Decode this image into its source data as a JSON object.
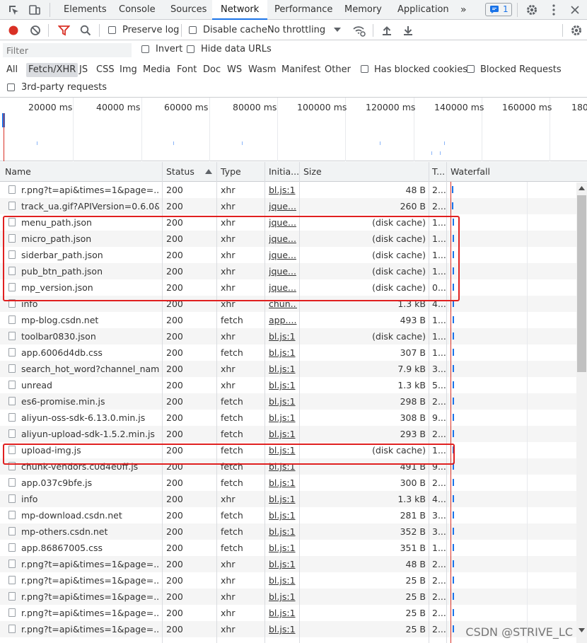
{
  "tabs": {
    "items": [
      "Elements",
      "Console",
      "Sources",
      "Network",
      "Performance",
      "Memory",
      "Application"
    ],
    "more": "»",
    "issues_count": "1"
  },
  "toolbar": {
    "preserve_log": "Preserve log",
    "disable_cache": "Disable cache",
    "throttling": "No throttling"
  },
  "filter": {
    "placeholder": "Filter",
    "invert": "Invert",
    "hide_data_urls": "Hide data URLs"
  },
  "types": {
    "items": [
      "All",
      "Fetch/XHR",
      "JS",
      "CSS",
      "Img",
      "Media",
      "Font",
      "Doc",
      "WS",
      "Wasm",
      "Manifest",
      "Other"
    ],
    "selected": "Fetch/XHR",
    "blocked_cookies": "Has blocked cookies",
    "blocked_requests": "Blocked Requests",
    "third_party": "3rd-party requests"
  },
  "overview": {
    "ticks": [
      "20000 ms",
      "40000 ms",
      "60000 ms",
      "80000 ms",
      "100000 ms",
      "120000 ms",
      "140000 ms",
      "160000 ms",
      "180"
    ]
  },
  "table": {
    "headers": {
      "name": "Name",
      "status": "Status",
      "type": "Type",
      "initiator": "Initia...",
      "size": "Size",
      "time": "T...",
      "waterfall": "Waterfall"
    },
    "rows": [
      {
        "name": "r.png?t=api&times=1&page=...",
        "status": "200",
        "type": "xhr",
        "initiator": "bl.js:1",
        "size": "48 B",
        "time": "2..."
      },
      {
        "name": "track_ua.gif?APIVersion=0.6.0&...",
        "status": "200",
        "type": "xhr",
        "initiator": "jque...",
        "size": "260 B",
        "time": "2..."
      },
      {
        "name": "menu_path.json",
        "status": "200",
        "type": "xhr",
        "initiator": "jque...",
        "size": "(disk cache)",
        "time": "1..."
      },
      {
        "name": "micro_path.json",
        "status": "200",
        "type": "xhr",
        "initiator": "jque...",
        "size": "(disk cache)",
        "time": "1..."
      },
      {
        "name": "siderbar_path.json",
        "status": "200",
        "type": "xhr",
        "initiator": "jque...",
        "size": "(disk cache)",
        "time": "1..."
      },
      {
        "name": "pub_btn_path.json",
        "status": "200",
        "type": "xhr",
        "initiator": "jque...",
        "size": "(disk cache)",
        "time": "1..."
      },
      {
        "name": "mp_version.json",
        "status": "200",
        "type": "xhr",
        "initiator": "jque...",
        "size": "(disk cache)",
        "time": "0..."
      },
      {
        "name": "info",
        "status": "200",
        "type": "xhr",
        "initiator": "chun...",
        "size": "1.3 kB",
        "time": "4..."
      },
      {
        "name": "mp-blog.csdn.net",
        "status": "200",
        "type": "fetch",
        "initiator": "app....",
        "size": "493 B",
        "time": "1..."
      },
      {
        "name": "toolbar0830.json",
        "status": "200",
        "type": "xhr",
        "initiator": "bl.js:1",
        "size": "(disk cache)",
        "time": "1..."
      },
      {
        "name": "app.6006d4db.css",
        "status": "200",
        "type": "fetch",
        "initiator": "bl.js:1",
        "size": "307 B",
        "time": "1..."
      },
      {
        "name": "search_hot_word?channel_nam...",
        "status": "200",
        "type": "xhr",
        "initiator": "bl.js:1",
        "size": "7.9 kB",
        "time": "3..."
      },
      {
        "name": "unread",
        "status": "200",
        "type": "xhr",
        "initiator": "bl.js:1",
        "size": "1.3 kB",
        "time": "5..."
      },
      {
        "name": "es6-promise.min.js",
        "status": "200",
        "type": "fetch",
        "initiator": "bl.js:1",
        "size": "298 B",
        "time": "2..."
      },
      {
        "name": "aliyun-oss-sdk-6.13.0.min.js",
        "status": "200",
        "type": "fetch",
        "initiator": "bl.js:1",
        "size": "308 B",
        "time": "9..."
      },
      {
        "name": "aliyun-upload-sdk-1.5.2.min.js",
        "status": "200",
        "type": "fetch",
        "initiator": "bl.js:1",
        "size": "293 B",
        "time": "2..."
      },
      {
        "name": "upload-img.js",
        "status": "200",
        "type": "fetch",
        "initiator": "bl.js:1",
        "size": "(disk cache)",
        "time": "1..."
      },
      {
        "name": "chunk-vendors.c0d4e0ff.js",
        "status": "200",
        "type": "fetch",
        "initiator": "bl.js:1",
        "size": "491 B",
        "time": "9..."
      },
      {
        "name": "app.037c9bfe.js",
        "status": "200",
        "type": "fetch",
        "initiator": "bl.js:1",
        "size": "300 B",
        "time": "2..."
      },
      {
        "name": "info",
        "status": "200",
        "type": "xhr",
        "initiator": "bl.js:1",
        "size": "1.3 kB",
        "time": "4..."
      },
      {
        "name": "mp-download.csdn.net",
        "status": "200",
        "type": "fetch",
        "initiator": "bl.js:1",
        "size": "281 B",
        "time": "3..."
      },
      {
        "name": "mp-others.csdn.net",
        "status": "200",
        "type": "fetch",
        "initiator": "bl.js:1",
        "size": "352 B",
        "time": "3..."
      },
      {
        "name": "app.86867005.css",
        "status": "200",
        "type": "fetch",
        "initiator": "bl.js:1",
        "size": "351 B",
        "time": "1..."
      },
      {
        "name": "r.png?t=api&times=1&page=...",
        "status": "200",
        "type": "xhr",
        "initiator": "bl.js:1",
        "size": "48 B",
        "time": "2..."
      },
      {
        "name": "r.png?t=api&times=1&page=...",
        "status": "200",
        "type": "xhr",
        "initiator": "bl.js:1",
        "size": "25 B",
        "time": "2..."
      },
      {
        "name": "r.png?t=api&times=1&page=...",
        "status": "200",
        "type": "xhr",
        "initiator": "bl.js:1",
        "size": "25 B",
        "time": "2..."
      },
      {
        "name": "r.png?t=api&times=1&page=...",
        "status": "200",
        "type": "xhr",
        "initiator": "bl.js:1",
        "size": "25 B",
        "time": "2..."
      },
      {
        "name": "r.png?t=api&times=1&page=...",
        "status": "200",
        "type": "xhr",
        "initiator": "bl.js:1",
        "size": "25 B",
        "time": "2..."
      }
    ]
  },
  "watermark": "CSDN @STRIVE_LC",
  "colors": {
    "accent": "#1a73e8",
    "highlight": "#e02020",
    "record": "#d93025",
    "filter_icon": "#d93025"
  }
}
